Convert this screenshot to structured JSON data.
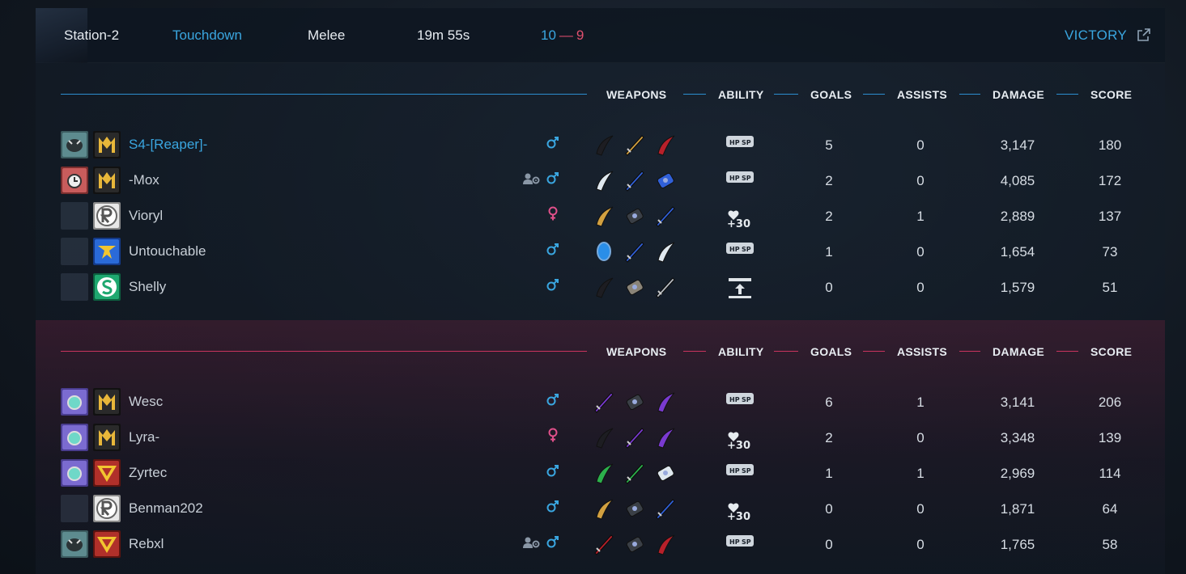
{
  "header": {
    "map": "Station-2",
    "mode": "Touchdown",
    "type": "Melee",
    "duration": "19m 55s",
    "score_blue": "10",
    "score_sep": "—",
    "score_red": "9",
    "result": "VICTORY"
  },
  "columns": {
    "weapons": "WEAPONS",
    "ability": "ABILITY",
    "goals": "GOALS",
    "assists": "ASSISTS",
    "damage": "DAMAGE",
    "score": "SCORE"
  },
  "colors": {
    "blue_accent": "#3aa6e0",
    "red_accent": "#e0506e",
    "male": "#3aa6e0",
    "female": "#e0508a"
  },
  "teams": [
    {
      "side": "blue",
      "players": [
        {
          "name": "S4-[Reaper]-",
          "gender": "male",
          "party": false,
          "icon_a": "wolf-emblem",
          "icon_b": "gold-m-rank",
          "weapons": [
            "black-claw",
            "gold-blade",
            "red-claw"
          ],
          "ability": "hp-sp-ability",
          "goals": "5",
          "assists": "0",
          "damage": "3,147",
          "score": "180",
          "me": true
        },
        {
          "name": "-Mox",
          "gender": "male",
          "party": true,
          "icon_a": "red-clock-emblem",
          "icon_b": "gold-m-rank",
          "weapons": [
            "white-fang",
            "blue-sword",
            "blue-gauntlet"
          ],
          "ability": "hp-sp-ability",
          "goals": "2",
          "assists": "0",
          "damage": "4,085",
          "score": "172",
          "me": false
        },
        {
          "name": "Vioryl",
          "gender": "female",
          "party": false,
          "icon_a": "",
          "icon_b": "silver-r-rank",
          "weapons": [
            "gold-dagger",
            "dark-gun",
            "blue-sword"
          ],
          "ability": "heal-30-ability",
          "goals": "2",
          "assists": "1",
          "damage": "2,889",
          "score": "137",
          "me": false
        },
        {
          "name": "Untouchable",
          "gender": "male",
          "party": false,
          "icon_a": "",
          "icon_b": "blue-p-rank",
          "weapons": [
            "blue-orb",
            "blue-sword",
            "white-fang"
          ],
          "ability": "hp-sp-ability",
          "goals": "1",
          "assists": "0",
          "damage": "1,654",
          "score": "73",
          "me": false
        },
        {
          "name": "Shelly",
          "gender": "male",
          "party": false,
          "icon_a": "",
          "icon_b": "green-s-rank",
          "weapons": [
            "black-claw",
            "stone-gauntlet",
            "steel-sword"
          ],
          "ability": "launch-ability",
          "goals": "0",
          "assists": "0",
          "damage": "1,579",
          "score": "51",
          "me": false
        }
      ]
    },
    {
      "side": "red",
      "players": [
        {
          "name": "Wesc",
          "gender": "male",
          "party": false,
          "icon_a": "purple-gem-emblem",
          "icon_b": "gold-m-rank",
          "weapons": [
            "purple-blade",
            "dark-gauntlet",
            "purple-claw"
          ],
          "ability": "hp-sp-ability",
          "goals": "6",
          "assists": "1",
          "damage": "3,141",
          "score": "206",
          "me": false
        },
        {
          "name": "Lyra-",
          "gender": "female",
          "party": false,
          "icon_a": "purple-gem-emblem",
          "icon_b": "gold-m-rank",
          "weapons": [
            "black-claw",
            "purple-sword",
            "purple-scythe"
          ],
          "ability": "heal-30-ability",
          "goals": "2",
          "assists": "0",
          "damage": "3,348",
          "score": "139",
          "me": false
        },
        {
          "name": "Zyrtec",
          "gender": "male",
          "party": false,
          "icon_a": "purple-gem-emblem",
          "icon_b": "red-v-rank",
          "weapons": [
            "green-claw",
            "green-sword",
            "white-gauntlet"
          ],
          "ability": "hp-sp-ability",
          "goals": "1",
          "assists": "1",
          "damage": "2,969",
          "score": "114",
          "me": false
        },
        {
          "name": "Benman202",
          "gender": "male",
          "party": false,
          "icon_a": "",
          "icon_b": "silver-r-rank",
          "weapons": [
            "gold-dagger",
            "dark-gauntlet",
            "blue-sword"
          ],
          "ability": "heal-30-ability",
          "goals": "0",
          "assists": "0",
          "damage": "1,871",
          "score": "64",
          "me": false
        },
        {
          "name": "Rebxl",
          "gender": "male",
          "party": true,
          "icon_a": "wolf-emblem",
          "icon_b": "red-v-rank",
          "weapons": [
            "red-chain-blade",
            "dark-gauntlet",
            "red-claw"
          ],
          "ability": "hp-sp-ability",
          "goals": "0",
          "assists": "0",
          "damage": "1,765",
          "score": "58",
          "me": false
        }
      ]
    }
  ]
}
